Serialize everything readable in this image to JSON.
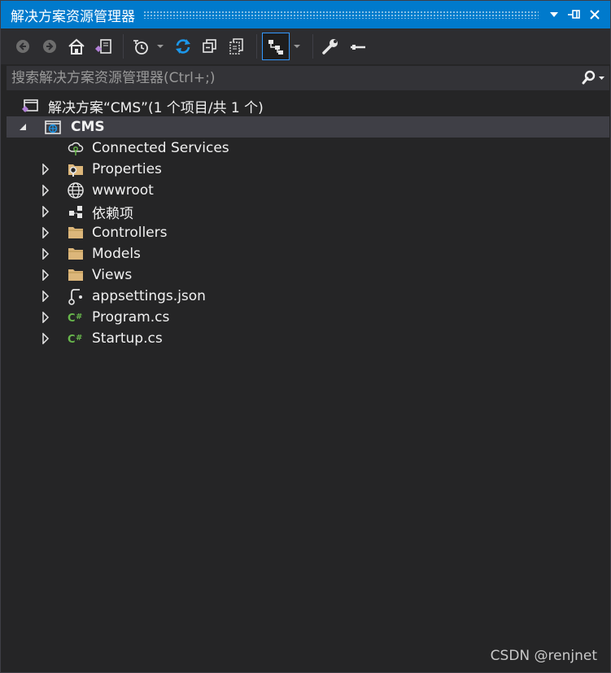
{
  "window": {
    "title": "解决方案资源管理器"
  },
  "search": {
    "placeholder": "搜索解决方案资源管理器(Ctrl+;)"
  },
  "solution": {
    "label": "解决方案“CMS”(1 个项目/共 1 个)"
  },
  "project": {
    "label": "CMS"
  },
  "items": [
    {
      "label": "Connected Services",
      "icon": "connected-services-icon",
      "expandable": false
    },
    {
      "label": "Properties",
      "icon": "properties-folder-icon",
      "expandable": true
    },
    {
      "label": "wwwroot",
      "icon": "globe-icon",
      "expandable": true
    },
    {
      "label": "依赖项",
      "icon": "dependencies-icon",
      "expandable": true
    },
    {
      "label": "Controllers",
      "icon": "folder-icon",
      "expandable": true
    },
    {
      "label": "Models",
      "icon": "folder-icon",
      "expandable": true
    },
    {
      "label": "Views",
      "icon": "folder-icon",
      "expandable": true
    },
    {
      "label": "appsettings.json",
      "icon": "json-file-icon",
      "expandable": true
    },
    {
      "label": "Program.cs",
      "icon": "csharp-file-icon",
      "expandable": true
    },
    {
      "label": "Startup.cs",
      "icon": "csharp-file-icon",
      "expandable": true
    }
  ],
  "watermark": "CSDN @renjnet",
  "colors": {
    "accent": "#007acc",
    "background": "#252526",
    "folder": "#dcb67a",
    "csharp": "#68b74c",
    "refresh": "#1c97ea"
  }
}
